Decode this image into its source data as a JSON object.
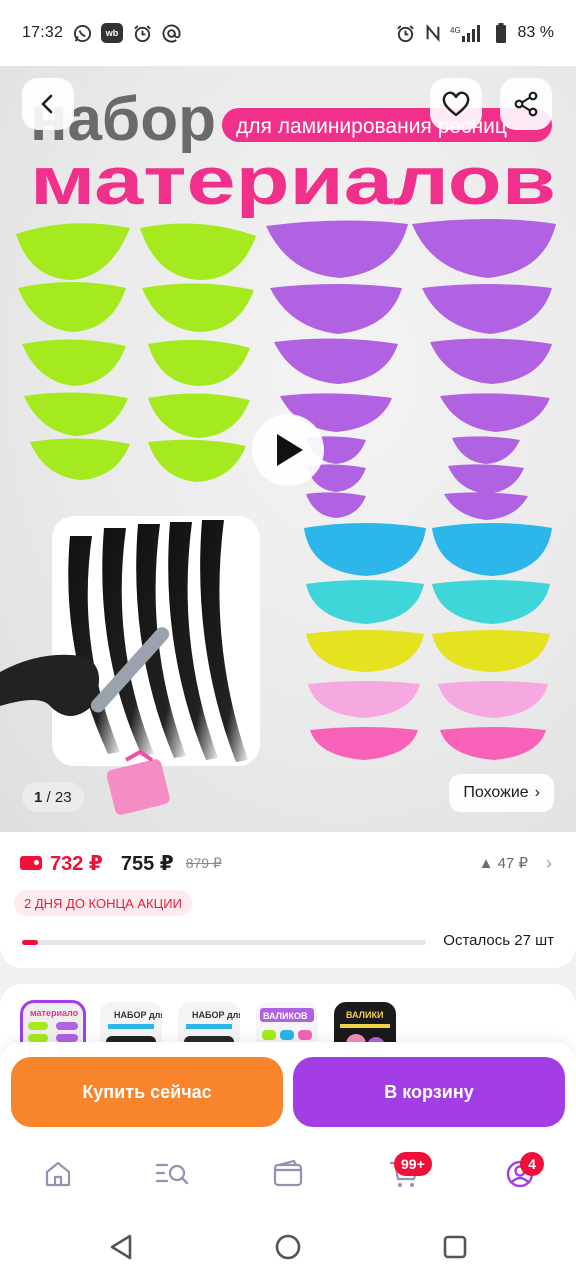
{
  "status_bar": {
    "time": "17:32",
    "notification_icons": [
      "whatsapp-icon",
      "wb-icon",
      "alarm-icon",
      "at-icon"
    ],
    "wb_label": "wb",
    "right_icons": [
      "alarm-icon",
      "nfc-icon",
      "signal-icon",
      "battery-icon"
    ],
    "signal_label": "4G",
    "battery": "83 %"
  },
  "hero": {
    "title_line1": "набор",
    "title_pill": "для ламинирования ресниц",
    "title_line2": "материалов",
    "counter_current": "1",
    "counter_total": "/ 23",
    "similar_label": "Похожие",
    "similar_chevron": "›"
  },
  "price": {
    "wallet_price": "732 ₽",
    "price": "755 ₽",
    "old_price": "879 ₽",
    "delta_label": "▲ 47 ₽",
    "delta_chevron": "›",
    "promo": "2 ДНЯ ДО КОНЦА АКЦИИ",
    "stock_label": "Осталось 27 шт",
    "stock_level": 0.04
  },
  "thumbnails": [
    {
      "label": "материало",
      "selected": true
    },
    {
      "label": "НАБОР для",
      "selected": false
    },
    {
      "label": "НАБОР для",
      "selected": false
    },
    {
      "label": "ВАЛИКОВ",
      "selected": false
    },
    {
      "label": "ВАЛИКИ",
      "selected": false
    }
  ],
  "actions": {
    "buy_now": "Купить сейчас",
    "add_to_cart": "В корзину"
  },
  "tabbar": {
    "cart_badge": "99+",
    "profile_badge": "4"
  },
  "colors": {
    "brand_purple": "#a33ee6",
    "buy_orange": "#f8852b",
    "price_red": "#f0103a",
    "title_pink": "#f0308a"
  }
}
